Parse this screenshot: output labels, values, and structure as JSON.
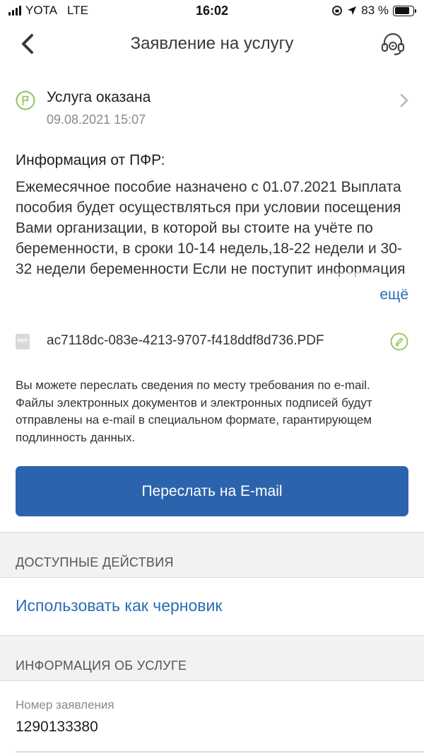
{
  "status_bar": {
    "carrier": "YOTA",
    "network": "LTE",
    "time": "16:02",
    "battery_text": "83 %",
    "battery_level": 0.83
  },
  "header": {
    "title": "Заявление на услугу",
    "back_icon": "chevron-left-icon",
    "support_icon": "headset-icon"
  },
  "status": {
    "title": "Услуга оказана",
    "date": "09.08.2021 15:07",
    "color": "#8fc35a"
  },
  "info": {
    "title": "Информация от ПФР:",
    "text": "Ежемесячное пособие назначено с 01.07.2021 Выплата пособия будет осуществляться при условии посещения Вами организации, в которой вы стоите на учёте по беременности, в сроки 10-14 недель,18-22 недели и 30-32 недели беременности Если не поступит информация",
    "more_label": "ещё"
  },
  "file": {
    "icon_label": "PDF",
    "name": "ac7118dc-083e-4213-9707-f418ddf8d736.PDF"
  },
  "note": "Вы можете переслать сведения по месту требования по e-mail. Файлы электронных документов и электронных подписей будут отправлены на e-mail в специальном формате, гарантирующем  подлинность данных.",
  "send_button": "Переслать на E-mail",
  "actions": {
    "header": "ДОСТУПНЫЕ ДЕЙСТВИЯ",
    "draft_label": "Использовать как черновик"
  },
  "service_info": {
    "header": "ИНФОРМАЦИЯ ОБ УСЛУГЕ",
    "number_label": "Номер заявления",
    "number_value": "1290133380"
  },
  "colors": {
    "primary": "#2c63ad",
    "link": "#2a6bb5",
    "success": "#8fc35a"
  }
}
